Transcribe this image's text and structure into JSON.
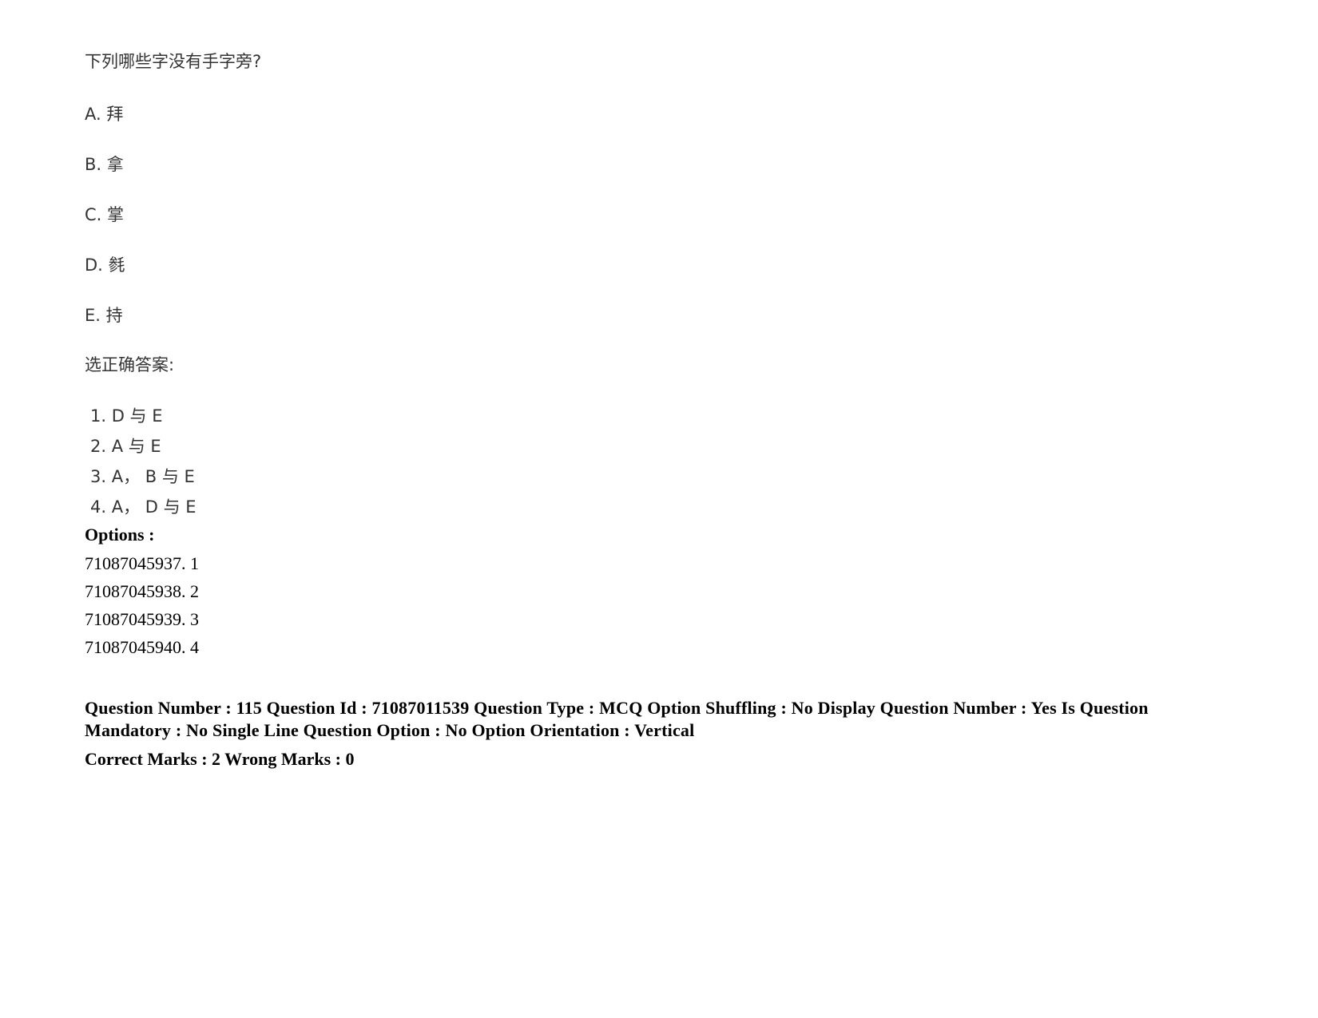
{
  "question": {
    "text": "下列哪些字没有手字旁?",
    "choices": [
      {
        "label": "A. 拜"
      },
      {
        "label": "B. 拿"
      },
      {
        "label": "C. 掌"
      },
      {
        "label": "D. 毵"
      },
      {
        "label": "E. 持"
      }
    ],
    "prompt": "选正确答案:",
    "answers": [
      {
        "label": "1. D 与 E"
      },
      {
        "label": "2. A 与 E"
      },
      {
        "label": "3. A， B 与 E"
      },
      {
        "label": "4. A， D 与 E"
      }
    ]
  },
  "options": {
    "heading": "Options :",
    "items": [
      {
        "label": "71087045937. 1"
      },
      {
        "label": "71087045938. 2"
      },
      {
        "label": "71087045939. 3"
      },
      {
        "label": "71087045940. 4"
      }
    ]
  },
  "meta": {
    "details": "Question Number : 115 Question Id : 71087011539 Question Type : MCQ Option Shuffling : No Display Question Number : Yes Is Question Mandatory : No Single Line Question Option : No Option Orientation : Vertical",
    "marks": "Correct Marks : 2 Wrong Marks : 0"
  }
}
